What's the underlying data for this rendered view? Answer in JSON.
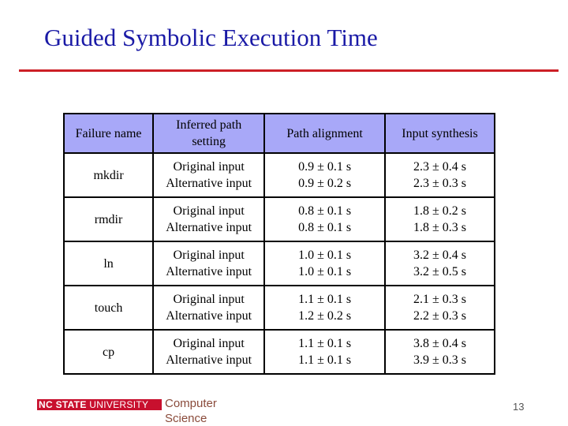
{
  "slide": {
    "title": "Guided Symbolic Execution Time",
    "accent_color": "#cc1f26",
    "title_color": "#1a1aa6",
    "header_color": "#a8a8f8"
  },
  "table": {
    "headers": [
      "Failure name",
      "Inferred path setting",
      "Path alignment",
      "Input synthesis"
    ],
    "header_setting_lines": [
      "Inferred path",
      "setting"
    ],
    "rows": [
      {
        "name": "mkdir",
        "settings": [
          "Original input",
          "Alternative input"
        ],
        "path_alignment": [
          "0.9 ± 0.1 s",
          "0.9 ± 0.2 s"
        ],
        "input_synthesis": [
          "2.3 ± 0.4 s",
          "2.3 ± 0.3 s"
        ]
      },
      {
        "name": "rmdir",
        "settings": [
          "Original input",
          "Alternative input"
        ],
        "path_alignment": [
          "0.8 ± 0.1 s",
          "0.8 ± 0.1 s"
        ],
        "input_synthesis": [
          "1.8 ± 0.2 s",
          "1.8 ± 0.3 s"
        ]
      },
      {
        "name": "ln",
        "settings": [
          "Original input",
          "Alternative input"
        ],
        "path_alignment": [
          "1.0 ± 0.1 s",
          "1.0 ± 0.1 s"
        ],
        "input_synthesis": [
          "3.2 ± 0.4 s",
          "3.2 ± 0.5 s"
        ]
      },
      {
        "name": "touch",
        "settings": [
          "Original input",
          "Alternative input"
        ],
        "path_alignment": [
          "1.1 ± 0.1 s",
          "1.2 ± 0.2 s"
        ],
        "input_synthesis": [
          "2.1 ± 0.3 s",
          "2.2 ± 0.3 s"
        ]
      },
      {
        "name": "cp",
        "settings": [
          "Original input",
          "Alternative input"
        ],
        "path_alignment": [
          "1.1 ± 0.1 s",
          "1.1 ± 0.1 s"
        ],
        "input_synthesis": [
          "3.8 ± 0.4 s",
          "3.9 ± 0.3 s"
        ]
      }
    ]
  },
  "footer": {
    "logo_bold": "NC STATE",
    "logo_rest": " UNIVERSITY",
    "dept_line1": "Computer",
    "dept_line2": "Science",
    "page_number": "13"
  }
}
